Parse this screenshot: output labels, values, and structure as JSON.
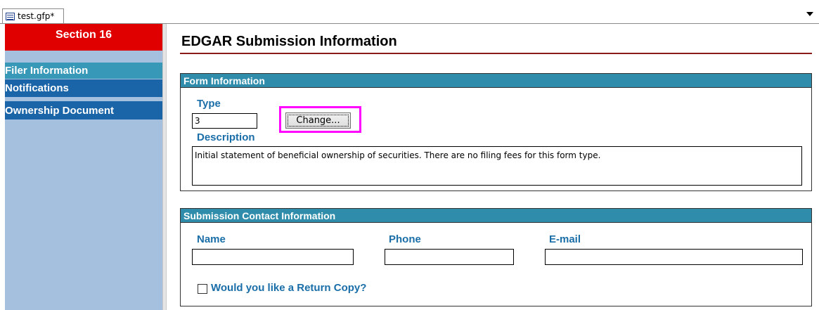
{
  "tab": {
    "title": "test.gfp*",
    "icon": "document-list-icon"
  },
  "sidebar": {
    "section_title": "Section 16",
    "items": [
      {
        "label": "Filer Information",
        "selected": true
      },
      {
        "label": "Notifications",
        "selected": false
      },
      {
        "label": "Ownership Document",
        "selected": false
      }
    ]
  },
  "main": {
    "title": "EDGAR Submission Information",
    "form_info": {
      "header": "Form Information",
      "type_label": "Type",
      "type_value": "3",
      "change_button": "Change...",
      "description_label": "Description",
      "description_value": "Initial statement of beneficial ownership of securities. There are no filing fees for this form type."
    },
    "contact_info": {
      "header": "Submission Contact Information",
      "name_label": "Name",
      "name_value": "",
      "phone_label": "Phone",
      "phone_value": "",
      "email_label": "E-mail",
      "email_value": "",
      "return_copy_label": "Would you like a Return Copy?",
      "return_copy_checked": false
    }
  },
  "colors": {
    "section_header": "#e00000",
    "nav_selected": "#3898b8",
    "nav_normal": "#1a64a8",
    "sidebar_bg": "#a5bfde",
    "group_header": "#2f8dab",
    "label_text": "#1a6ea8",
    "title_rule": "#8b1a1a",
    "highlight": "#ff00ff"
  }
}
